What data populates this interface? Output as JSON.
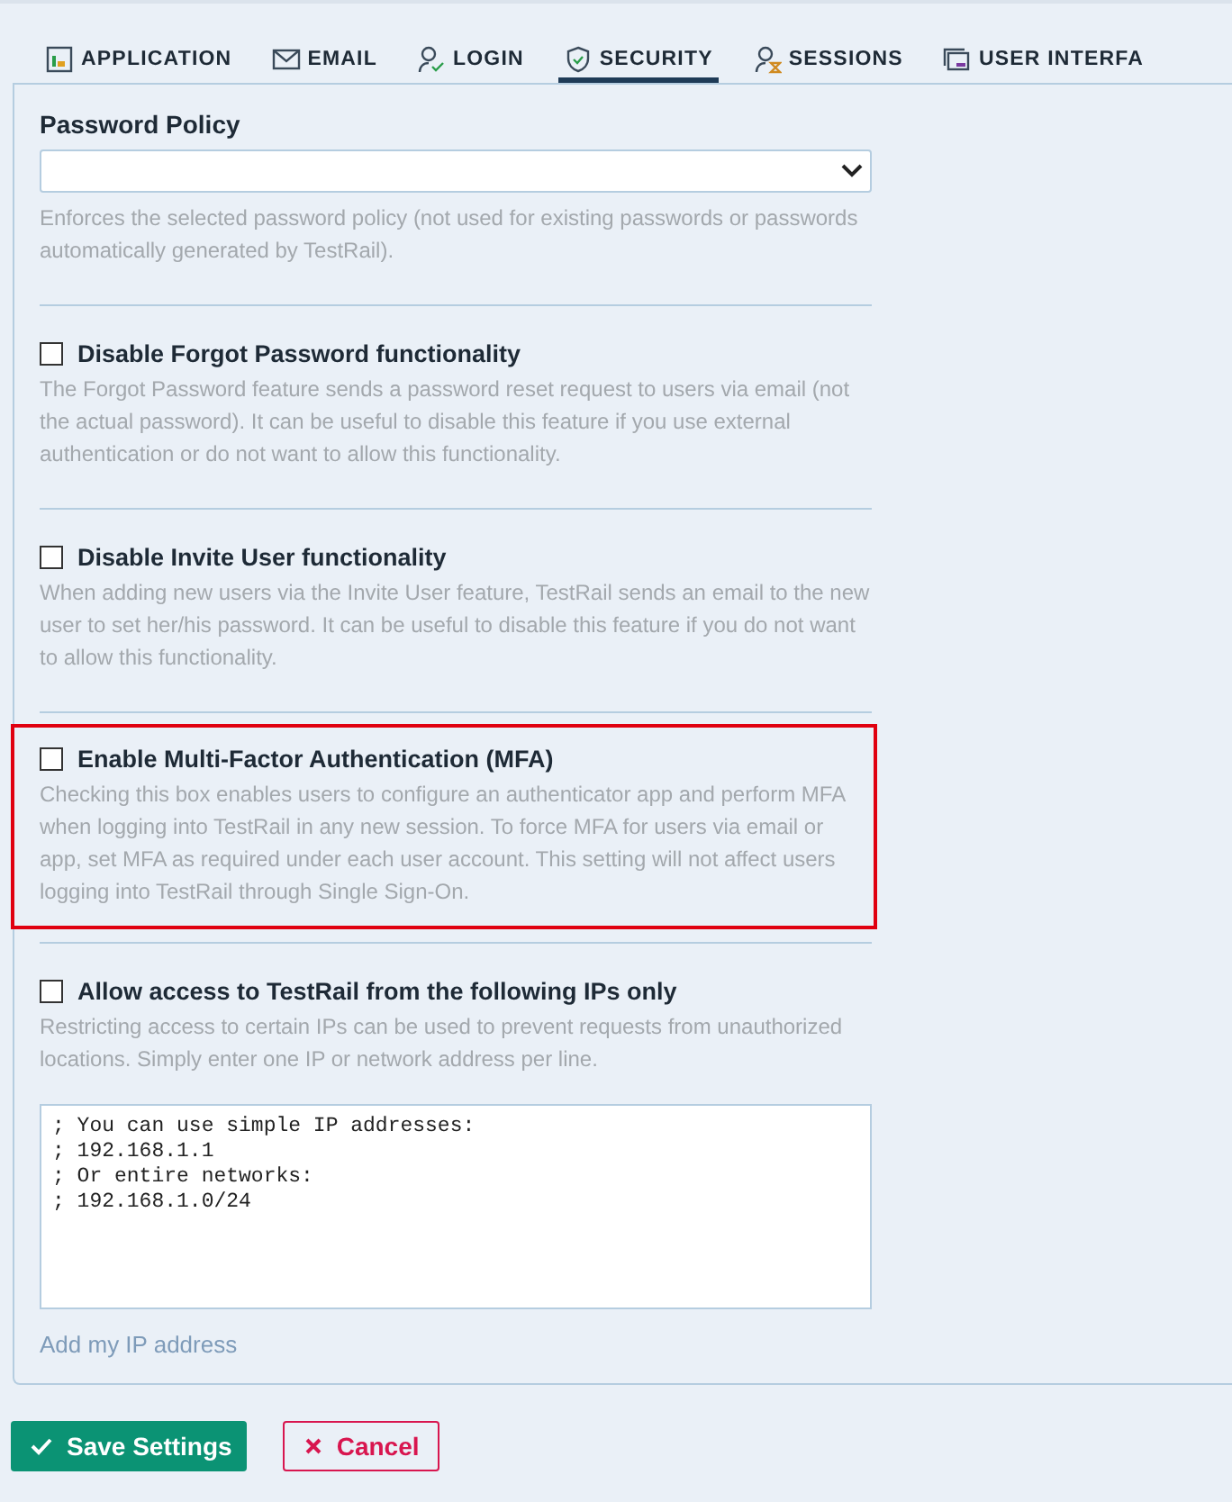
{
  "tabs": [
    {
      "label": "APPLICATION",
      "selected": false
    },
    {
      "label": "EMAIL",
      "selected": false
    },
    {
      "label": "LOGIN",
      "selected": false
    },
    {
      "label": "SECURITY",
      "selected": true
    },
    {
      "label": "SESSIONS",
      "selected": false
    },
    {
      "label": "USER INTERFA",
      "selected": false
    }
  ],
  "password_policy": {
    "label": "Password Policy",
    "help": "Enforces the selected password policy (not used for existing passwords or passwords automatically generated by TestRail)."
  },
  "options": [
    {
      "label": "Disable Forgot Password functionality",
      "checked": false,
      "highlighted": false,
      "help": "The Forgot Password feature sends a password reset request to users via email (not the actual password). It can be useful to disable this feature if you use external authentication or do not want to allow this functionality."
    },
    {
      "label": "Disable Invite User functionality",
      "checked": false,
      "highlighted": false,
      "help": "When adding new users via the Invite User feature, TestRail sends an email to the new user to set her/his password. It can be useful to disable this feature if you do not want to allow this functionality."
    },
    {
      "label": "Enable Multi-Factor Authentication (MFA)",
      "checked": false,
      "highlighted": true,
      "help": "Checking this box enables users to configure an authenticator app and perform MFA when logging into TestRail in any new session. To force MFA for users via email or app, set MFA as required under each user account. This setting will not affect users logging into TestRail through Single Sign-On."
    },
    {
      "label": "Allow access to TestRail from the following IPs only",
      "checked": false,
      "highlighted": false,
      "help": "Restricting access to certain IPs can be used to prevent requests from unauthorized locations. Simply enter one IP or network address per line."
    }
  ],
  "ip_list": {
    "value": "; You can use simple IP addresses:\n; 192.168.1.1\n; Or entire networks:\n; 192.168.1.0/24",
    "link": "Add my IP address"
  },
  "buttons": [
    {
      "label": "Save Settings",
      "kind": "primary"
    },
    {
      "label": "Cancel",
      "kind": "cancel"
    }
  ]
}
